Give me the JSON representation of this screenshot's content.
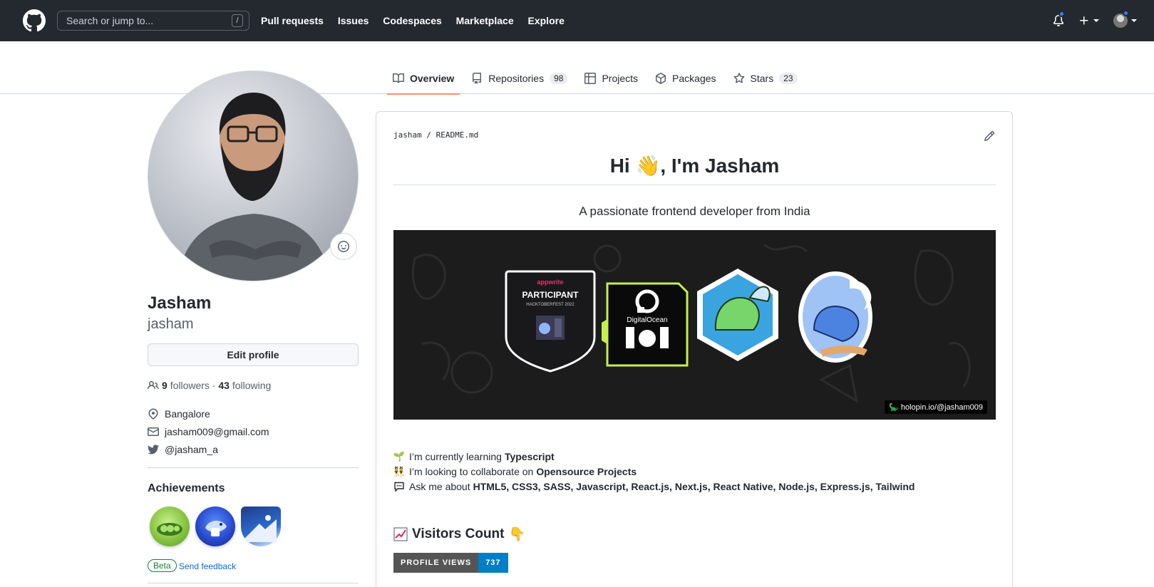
{
  "header": {
    "search_placeholder": "Search or jump to...",
    "search_shortcut": "/",
    "nav": [
      "Pull requests",
      "Issues",
      "Codespaces",
      "Marketplace",
      "Explore"
    ]
  },
  "tabs": [
    {
      "label": "Overview",
      "icon": "book-icon"
    },
    {
      "label": "Repositories",
      "icon": "repo-icon",
      "count": "98"
    },
    {
      "label": "Projects",
      "icon": "table-icon"
    },
    {
      "label": "Packages",
      "icon": "package-icon"
    },
    {
      "label": "Stars",
      "icon": "star-icon",
      "count": "23"
    }
  ],
  "profile": {
    "name": "Jasham",
    "login": "jasham",
    "edit_label": "Edit profile",
    "followers": "9",
    "followers_label": "followers",
    "sep": "·",
    "following": "43",
    "following_label": "following",
    "location": "Bangalore",
    "email": "jasham009@gmail.com",
    "twitter": "@jasham_a",
    "achievements_title": "Achievements",
    "beta_label": "Beta",
    "feedback_label": "Send feedback"
  },
  "readme": {
    "path_user": "jasham",
    "path_sep": "/",
    "path_file": "README.md",
    "heading_pre": "Hi ",
    "heading_emoji": "👋",
    "heading_post": ", I'm Jasham",
    "subtitle": "A passionate frontend developer from India",
    "holopin_tag": "holopin.io/@jasham009",
    "badges": {
      "appwrite_brand": "appwrite",
      "appwrite_title": "PARTICIPANT",
      "appwrite_sub": "HACKTOBERFEST 2022",
      "do_brand": "DigitalOcean"
    },
    "line1_text": "I’m currently learning",
    "line1_bold": "Typescript",
    "line2_text": "I’m looking to collaborate on",
    "line2_bold": "Opensource Projects",
    "line3_text": "Ask me about",
    "line3_bold": "HTML5, CSS3, SASS, Javascript, React.js, Next.js, React Native, Node.js, Express.js, Tailwind",
    "visitors_title": "Visitors Count",
    "views_label": "PROFILE VIEWS",
    "views_count": "737"
  }
}
